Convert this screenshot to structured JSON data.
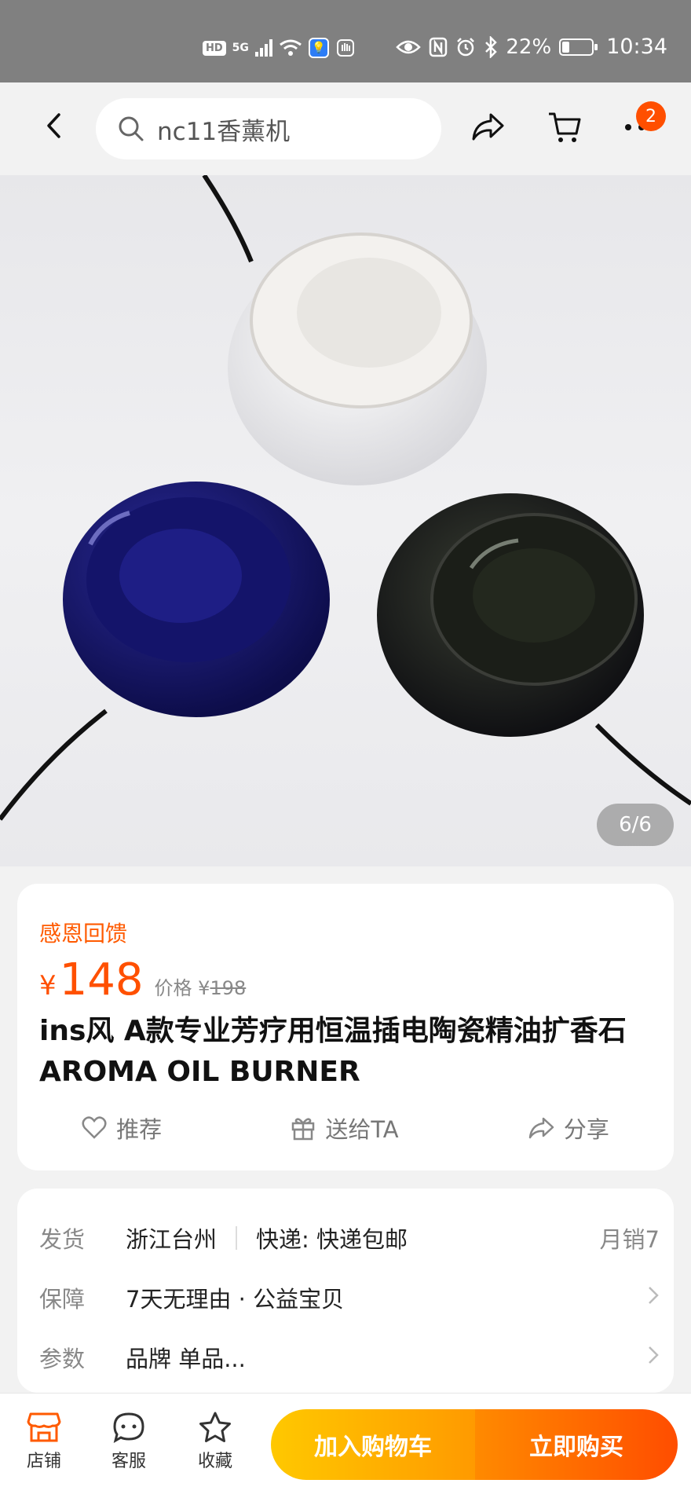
{
  "status_bar": {
    "hd": "HD",
    "network": "5G",
    "battery": "22%",
    "time": "10:34"
  },
  "header": {
    "search_text": "nc11香薰机",
    "cart_badge": "2"
  },
  "gallery": {
    "counter": "6/6"
  },
  "product": {
    "promo_label": "感恩回馈",
    "currency": "¥",
    "price": "148",
    "original_price_label": "价格",
    "original_currency": "¥",
    "original_price": "198",
    "title": "ins风 A款专业芳疗用恒温插电陶瓷精油扩香石AROMA OIL BURNER"
  },
  "actions": [
    {
      "label": "推荐",
      "icon": "heart-icon"
    },
    {
      "label": "送给TA",
      "icon": "gift-icon"
    },
    {
      "label": "分享",
      "icon": "share-icon"
    }
  ],
  "details": {
    "ship_key": "发货",
    "ship_origin": "浙江台州",
    "ship_express": "快递: 快递包邮",
    "monthly_sales": "月销7",
    "guarantee_key": "保障",
    "guarantee_value": "7天无理由 · 公益宝贝",
    "params_key": "参数",
    "params_value": "品牌 单品..."
  },
  "bottom_bar": {
    "shop": "店铺",
    "service": "客服",
    "favorite": "收藏",
    "add_to_cart": "加入购物车",
    "buy_now": "立即购买"
  },
  "colors": {
    "accent": "#ff5000",
    "cart_button": "#ffb000",
    "buy_button": "#ff5a00"
  }
}
